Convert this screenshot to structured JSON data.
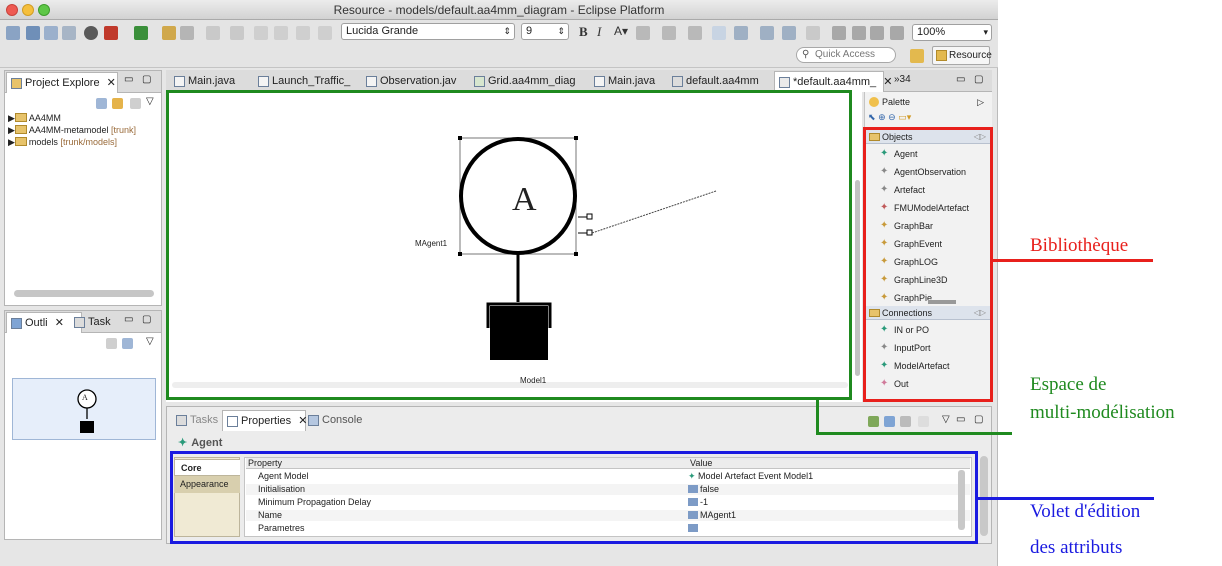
{
  "window": {
    "title": "Resource - models/default.aa4mm_diagram - Eclipse Platform",
    "font_combo": "Lucida Grande",
    "size_combo": "9",
    "zoom_combo": "100%",
    "quick_access": "Quick Access",
    "perspective_button": "Resource"
  },
  "project_explorer": {
    "tab_label": "Project Explore",
    "items": [
      "AA4MM",
      "AA4MM-metamodel",
      "models"
    ],
    "item_suffixes": [
      "",
      "[trunk]",
      "[trunk/models]"
    ]
  },
  "outline": {
    "tab_outline": "Outli",
    "tab_task": "Task",
    "mini_label": "A"
  },
  "editor": {
    "tabs": [
      "Main.java",
      "Launch_Traffic_",
      "Observation.jav",
      "Grid.aa4mm_diag",
      "Main.java",
      "default.aa4mm",
      "*default.aa4mm_"
    ],
    "overflow_label": "»34",
    "agent_letter": "A",
    "agent_name": "MAgent1",
    "model_name": "Model1"
  },
  "palette": {
    "title": "Palette",
    "objects_header": "Objects",
    "objects": [
      "Agent",
      "AgentObservation",
      "Artefact",
      "FMUModelArtefact",
      "GraphBar",
      "GraphEvent",
      "GraphLOG",
      "GraphLine3D",
      "GraphPie"
    ],
    "connections_header": "Connections",
    "connections": [
      "IN or PO",
      "InputPort",
      "ModelArtefact",
      "Out"
    ]
  },
  "bottom_panel": {
    "tabs": [
      "Tasks",
      "Properties",
      "Console"
    ],
    "selection_title": "Agent",
    "side_tabs": [
      "Core",
      "Appearance"
    ],
    "col_property": "Property",
    "col_value": "Value",
    "rows": [
      {
        "property": "Agent Model",
        "value": "Model Artefact Event Model1"
      },
      {
        "property": "Initialisation",
        "value": "false"
      },
      {
        "property": "Minimum Propagation Delay",
        "value": "-1"
      },
      {
        "property": "Name",
        "value": "MAgent1"
      },
      {
        "property": "Parametres",
        "value": ""
      }
    ]
  },
  "annotations": {
    "library": "Bibliothèque",
    "space_line1": "Espace de",
    "space_line2": "multi-modélisation",
    "edit_line1": "Volet d'édition",
    "edit_line2": "des attributs"
  },
  "colors": {
    "library_red": "#e8201c",
    "space_green": "#1f8a1f",
    "edit_blue": "#1a1ae0"
  }
}
